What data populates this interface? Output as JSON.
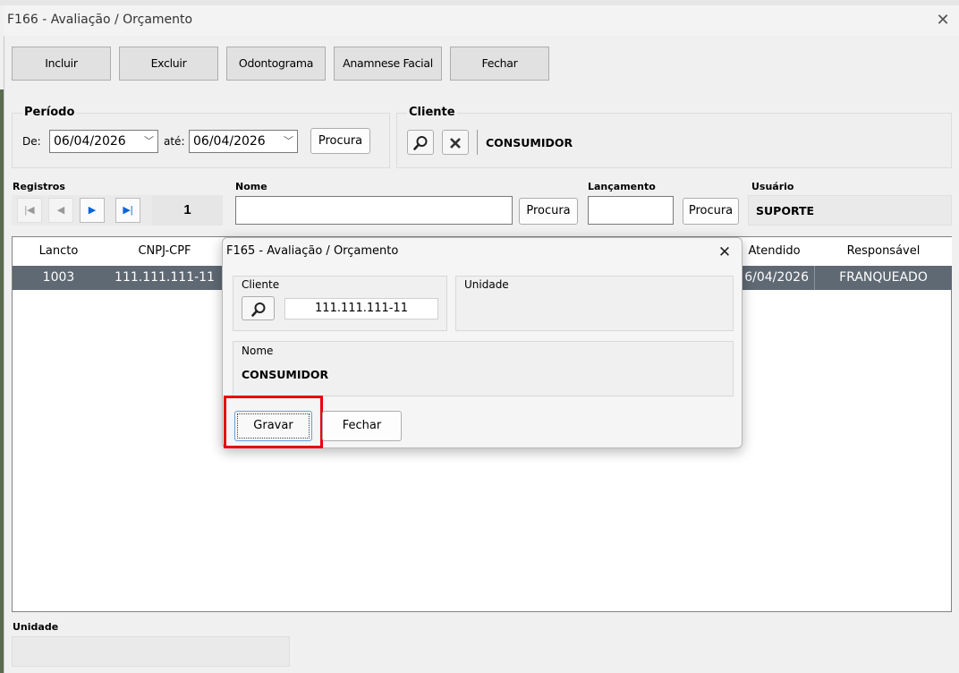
{
  "window": {
    "title": "F166 - Avaliação / Orçamento",
    "close": "✕"
  },
  "toolbar": {
    "incluir": "Incluir",
    "excluir": "Excluir",
    "odontograma": "Odontograma",
    "anamnese": "Anamnese Facial",
    "fechar": "Fechar"
  },
  "periodo": {
    "label": "Período",
    "de_label": "De:",
    "de_value": "06/04/2026",
    "ate_label": "até:",
    "ate_value": "06/04/2026",
    "procura": "Procura"
  },
  "cliente": {
    "label": "Cliente",
    "name": "CONSUMIDOR"
  },
  "registros": {
    "label": "Registros",
    "count": "1"
  },
  "nome": {
    "label": "Nome",
    "value": "",
    "procura": "Procura"
  },
  "lancamento": {
    "label": "Lançamento",
    "value": "",
    "procura": "Procura"
  },
  "usuario": {
    "label": "Usuário",
    "value": "SUPORTE"
  },
  "grid": {
    "columns": [
      "Lancto",
      "CNPJ-CPF",
      "Atendido",
      "Responsável"
    ],
    "rows": [
      {
        "lancto": "1003",
        "cnpj": "111.111.111-11",
        "atendido": "6/04/2026",
        "responsavel": "FRANQUEADO"
      }
    ]
  },
  "unidade": {
    "label": "Unidade",
    "value": ""
  },
  "dialog": {
    "title": "F165 - Avaliação / Orçamento",
    "close": "✕",
    "cliente_label": "Cliente",
    "cliente_value": "111.111.111-11",
    "unidade_label": "Unidade",
    "nome_label": "Nome",
    "nome_value": "CONSUMIDOR",
    "gravar": "Gravar",
    "fechar": "Fechar",
    "highlight_color": "#e8000b"
  },
  "colors": {
    "selected_row": "#5f6973",
    "nav_blue": "#0a64d8"
  }
}
